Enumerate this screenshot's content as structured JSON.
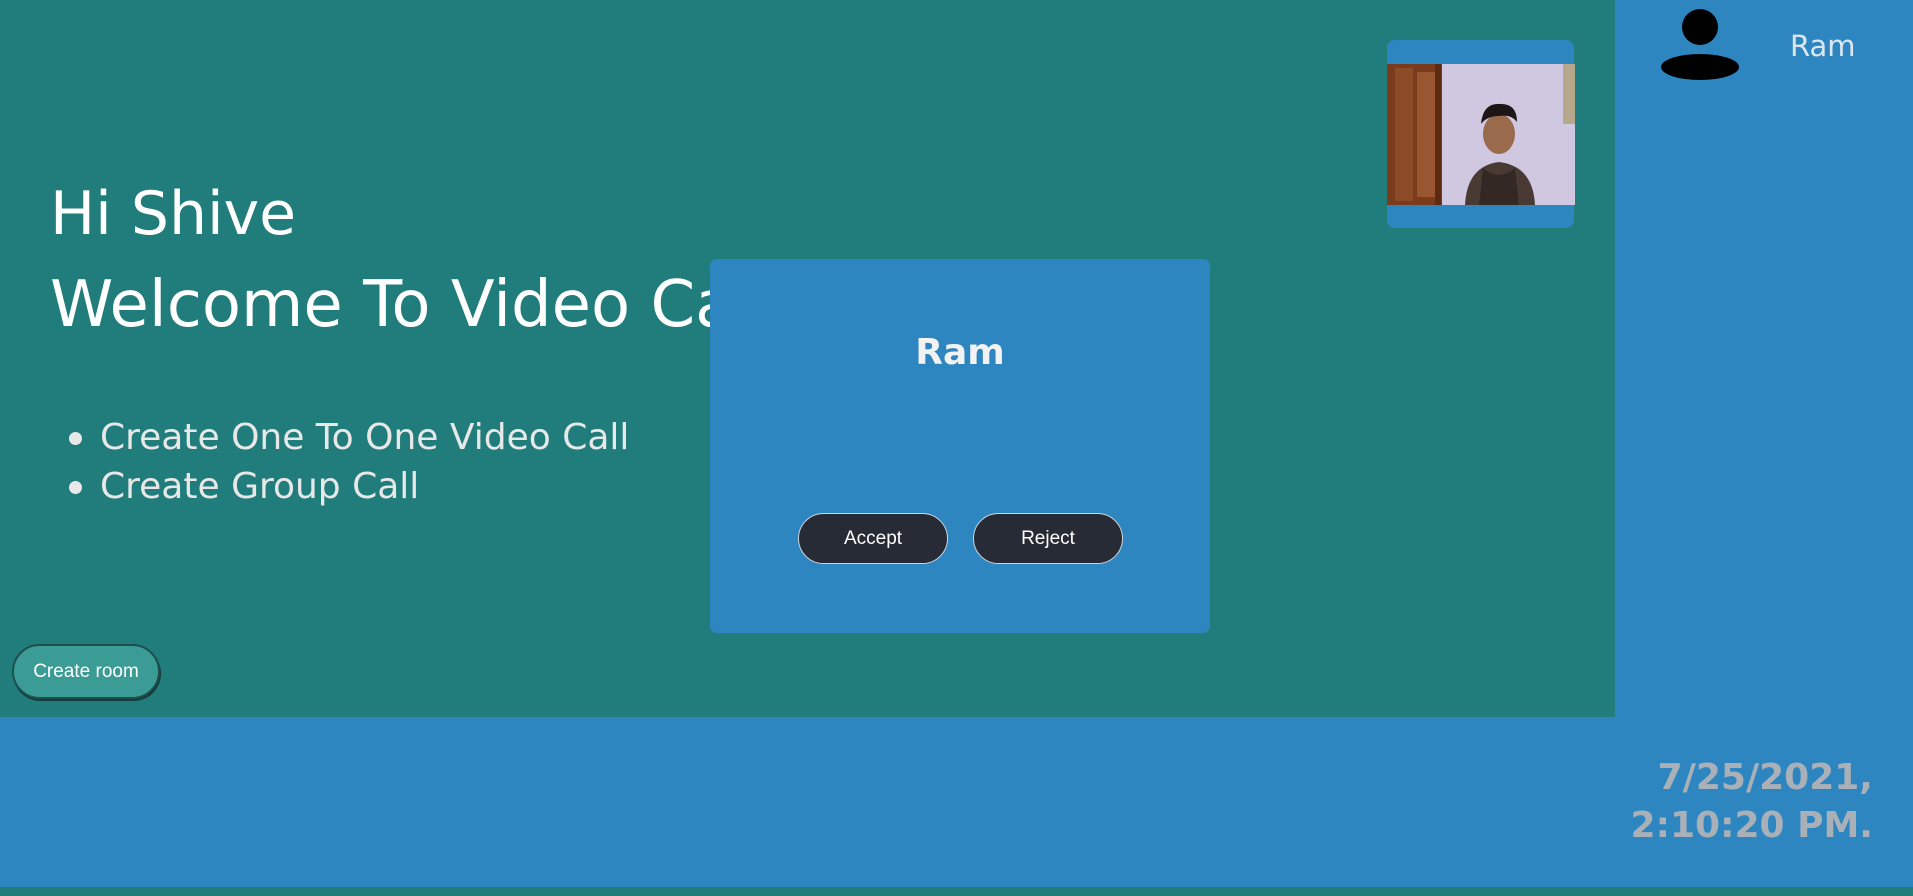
{
  "main": {
    "greeting": "Hi Shive",
    "welcome": "Welcome To Video Ca",
    "features": [
      "Create One To One Video Call",
      "Create Group Call"
    ],
    "create_room_label": "Create room"
  },
  "sidebar": {
    "avatar_icon": "user-icon",
    "caller_name": "Ram"
  },
  "video_tile": {
    "description_icon": "webcam-feed"
  },
  "incoming_call": {
    "caller_name": "Ram",
    "accept_label": "Accept",
    "reject_label": "Reject"
  },
  "footer": {
    "date": "7/25/2021,",
    "time": "2:10:20 PM."
  },
  "colors": {
    "teal": "#217d7b",
    "blue": "#2e86c0",
    "dark_button": "#272b35",
    "create_room_button": "#3b9b95"
  }
}
